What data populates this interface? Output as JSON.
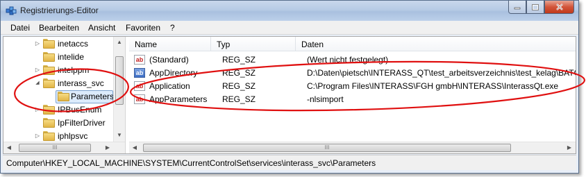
{
  "window": {
    "title": "Registrierungs-Editor",
    "controls": {
      "minimize": "minimize",
      "maximize": "maximize",
      "close": "close"
    }
  },
  "menu": [
    {
      "label": "Datei"
    },
    {
      "label": "Bearbeiten"
    },
    {
      "label": "Ansicht"
    },
    {
      "label": "Favoriten"
    },
    {
      "label": "?"
    }
  ],
  "tree": {
    "items": [
      {
        "label": "inetaccs",
        "expander": "▷"
      },
      {
        "label": "intelide",
        "expander": ""
      },
      {
        "label": "intelppm",
        "expander": "▷"
      },
      {
        "label": "interass_svc",
        "expander": "◢"
      },
      {
        "label": "Parameters",
        "expander": "",
        "selected": true
      },
      {
        "label": "IPBusEnum",
        "expander": "▷"
      },
      {
        "label": "IpFilterDriver",
        "expander": ""
      },
      {
        "label": "iphlpsvc",
        "expander": "▷"
      }
    ],
    "hscroll_grip": "III"
  },
  "values": {
    "columns": [
      "Name",
      "Typ",
      "Daten"
    ],
    "rows": [
      {
        "name": "(Standard)",
        "type": "REG_SZ",
        "data": "(Wert nicht festgelegt)",
        "icon": "ab"
      },
      {
        "name": "AppDirectory",
        "type": "REG_SZ",
        "data": "D:\\Daten\\pietsch\\INTERASS_QT\\test_arbeitsverzeichnis\\test_kelag\\BATCH",
        "icon": "ab"
      },
      {
        "name": "Application",
        "type": "REG_SZ",
        "data": "C:\\Program Files\\INTERASS\\FGH gmbH\\INTERASS\\InterassQt.exe",
        "icon": "ab"
      },
      {
        "name": "AppParameters",
        "type": "REG_SZ",
        "data": "-nlsimport",
        "icon": "ab"
      }
    ],
    "hscroll_grip": "III"
  },
  "status": {
    "path": "Computer\\HKEY_LOCAL_MACHINE\\SYSTEM\\CurrentControlSet\\services\\interass_svc\\Parameters"
  },
  "colors": {
    "annotation": "#e01010",
    "selection": "#dcebfc",
    "close_button": "#c8462a"
  }
}
